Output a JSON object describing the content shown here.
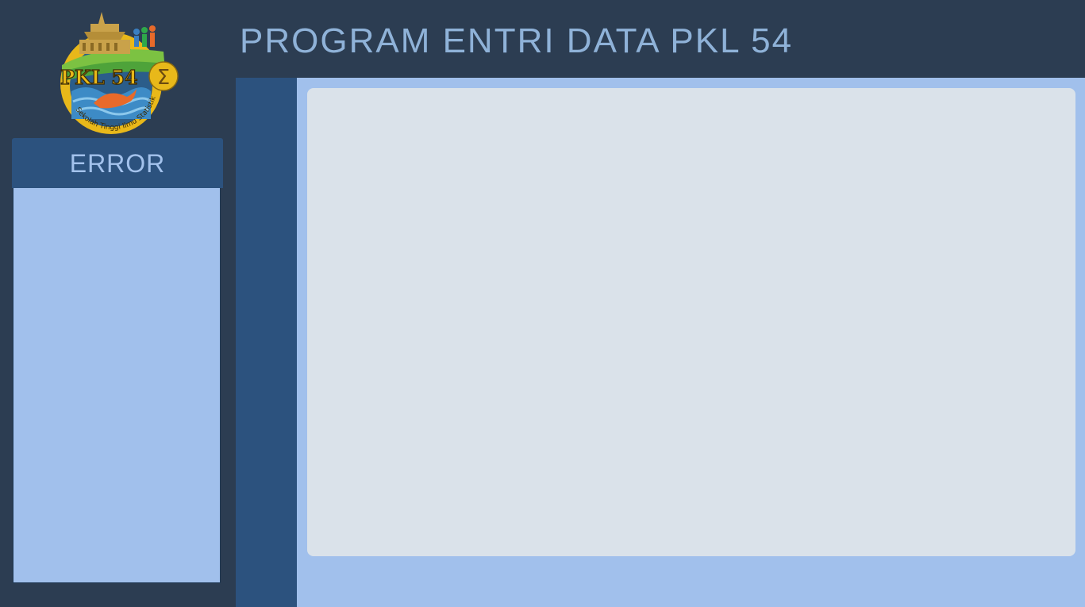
{
  "header": {
    "title": "PROGRAM ENTRI DATA PKL 54"
  },
  "logo": {
    "text_main": "PKL 54",
    "text_ring": "Sekolah Tinggi Ilmu Statistik",
    "sigma": "Σ"
  },
  "error_panel": {
    "title": "ERROR",
    "items": []
  },
  "colors": {
    "background": "#2c3d52",
    "nav_strip": "#2c527e",
    "panel_header": "#2c527e",
    "panel_body": "#a1c0ec",
    "workspace": "#a1c0ec",
    "content_card": "#dae2ea",
    "title_text": "#8fb2d8"
  }
}
